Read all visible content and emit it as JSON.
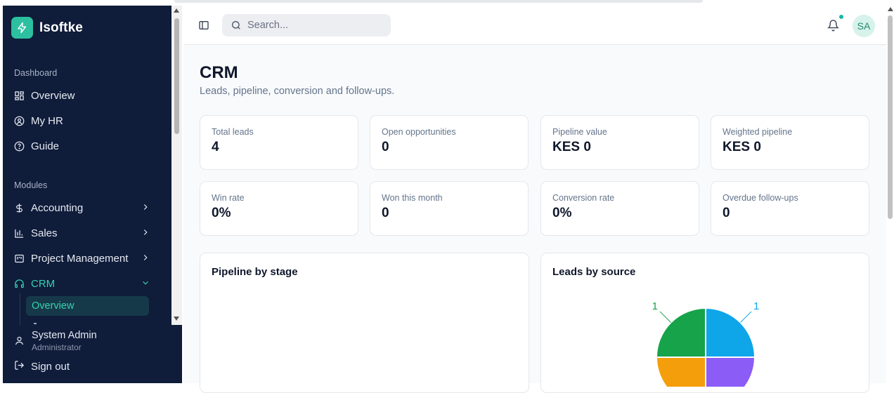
{
  "brand": {
    "name": "Isoftke",
    "color": "#2cc0a0"
  },
  "sidebar": {
    "sections": [
      {
        "label": "Dashboard"
      },
      {
        "label": "Modules"
      }
    ],
    "dashboard_items": [
      {
        "label": "Overview",
        "icon": "layout-grid-icon"
      },
      {
        "label": "My HR",
        "icon": "user-circle-icon"
      },
      {
        "label": "Guide",
        "icon": "help-circle-icon"
      }
    ],
    "module_items": [
      {
        "label": "Accounting",
        "icon": "dollar-icon",
        "expanded": false
      },
      {
        "label": "Sales",
        "icon": "bar-chart-icon",
        "expanded": false
      },
      {
        "label": "Project Management",
        "icon": "kanban-icon",
        "expanded": false
      },
      {
        "label": "CRM",
        "icon": "headset-icon",
        "expanded": true,
        "active": true
      }
    ],
    "crm_subitems": [
      {
        "label": "Overview",
        "active": true
      }
    ],
    "user": {
      "name": "System Admin",
      "role": "Administrator"
    },
    "signout_label": "Sign out"
  },
  "topbar": {
    "search_placeholder": "Search...",
    "avatar_initials": "SA",
    "notification_dot_color": "#14b8a6"
  },
  "page": {
    "title": "CRM",
    "subtitle": "Leads, pipeline, conversion and follow-ups."
  },
  "kpis": [
    {
      "label": "Total leads",
      "value": "4"
    },
    {
      "label": "Open opportunities",
      "value": "0"
    },
    {
      "label": "Pipeline value",
      "value": "KES 0"
    },
    {
      "label": "Weighted pipeline",
      "value": "KES 0"
    },
    {
      "label": "Win rate",
      "value": "0%"
    },
    {
      "label": "Won this month",
      "value": "0"
    },
    {
      "label": "Conversion rate",
      "value": "0%"
    },
    {
      "label": "Overdue follow-ups",
      "value": "0"
    }
  ],
  "cards": {
    "pipeline_by_stage": {
      "title": "Pipeline by stage"
    },
    "leads_by_source": {
      "title": "Leads by source"
    }
  },
  "chart_data": {
    "type": "pie",
    "title": "Leads by source",
    "slices": [
      {
        "value": 1,
        "color": "#0ea5e9",
        "label": "1"
      },
      {
        "value": 1,
        "color": "#8b5cf6",
        "label": ""
      },
      {
        "value": 1,
        "color": "#f59e0b",
        "label": ""
      },
      {
        "value": 1,
        "color": "#16a34a",
        "label": "1"
      }
    ]
  }
}
